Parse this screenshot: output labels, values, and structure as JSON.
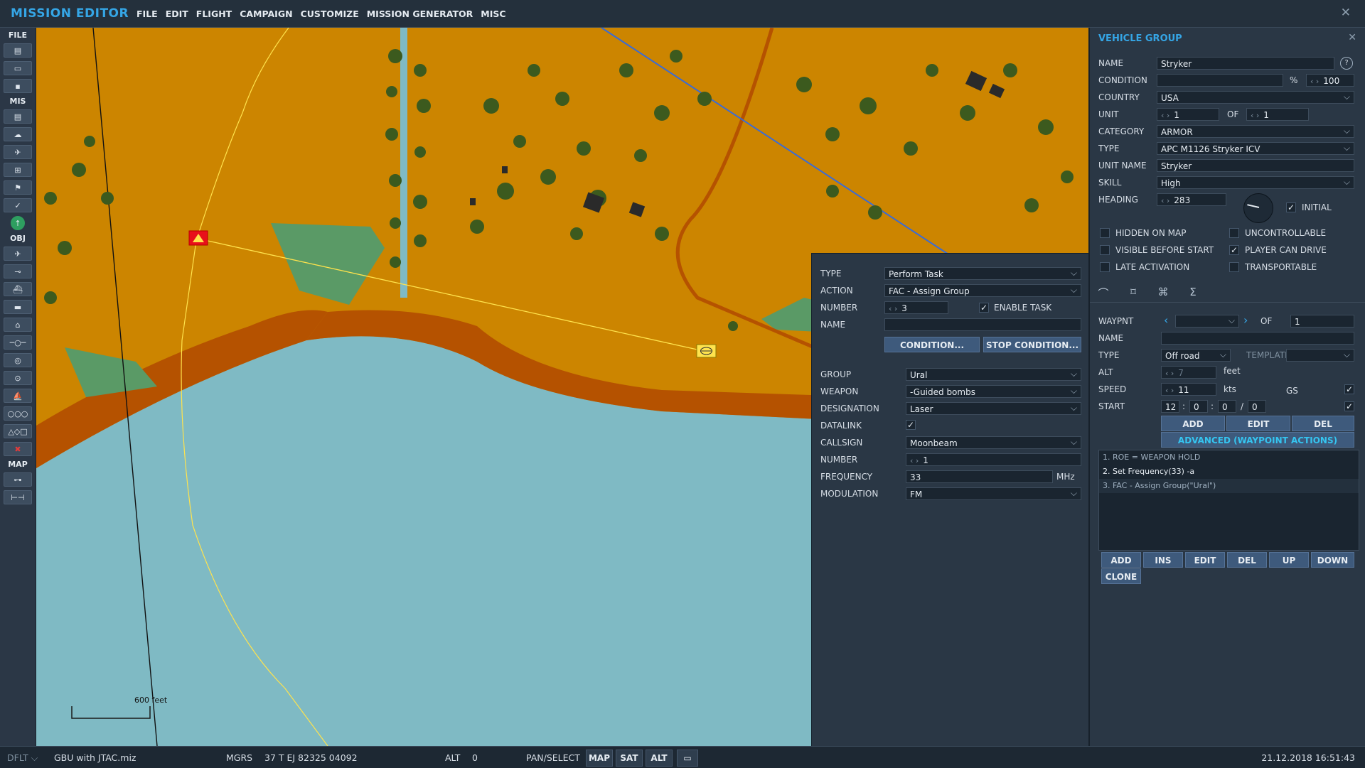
{
  "app": {
    "title": "MISSION EDITOR"
  },
  "menu": [
    "FILE",
    "EDIT",
    "FLIGHT",
    "CAMPAIGN",
    "CUSTOMIZE",
    "MISSION GENERATOR",
    "MISC"
  ],
  "toolbar": {
    "file_label": "FILE",
    "mis_label": "MIS",
    "obj_label": "OBJ",
    "map_label": "MAP"
  },
  "map": {
    "scale_label": "600 feet"
  },
  "task": {
    "type_label": "TYPE",
    "type_value": "Perform Task",
    "action_label": "ACTION",
    "action_value": "FAC - Assign Group",
    "number_label": "NUMBER",
    "number_value": "3",
    "enable_label": "ENABLE TASK",
    "name_label": "NAME",
    "name_value": "",
    "condition_btn": "CONDITION...",
    "stop_condition_btn": "STOP CONDITION...",
    "group_label": "GROUP",
    "group_value": "Ural",
    "weapon_label": "WEAPON",
    "weapon_value": "-Guided bombs",
    "designation_label": "DESIGNATION",
    "designation_value": "Laser",
    "datalink_label": "DATALINK",
    "callsign_label": "CALLSIGN",
    "callsign_value": "Moonbeam",
    "number2_label": "NUMBER",
    "number2_value": "1",
    "frequency_label": "FREQUENCY",
    "frequency_value": "33",
    "frequency_unit": "MHz",
    "modulation_label": "MODULATION",
    "modulation_value": "FM"
  },
  "vehicle": {
    "title": "VEHICLE GROUP",
    "name_label": "NAME",
    "name_value": "Stryker",
    "condition_label": "CONDITION",
    "condition_unit": "%",
    "condition_value": "100",
    "country_label": "COUNTRY",
    "country_value": "USA",
    "unit_label": "UNIT",
    "unit_value": "1",
    "unit_of": "OF",
    "unit_total": "1",
    "category_label": "CATEGORY",
    "category_value": "ARMOR",
    "type_label": "TYPE",
    "type_value": "APC M1126 Stryker ICV",
    "unitname_label": "UNIT NAME",
    "unitname_value": "Stryker",
    "skill_label": "SKILL",
    "skill_value": "High",
    "heading_label": "HEADING",
    "heading_value": "283",
    "initial_label": "INITIAL",
    "hidden_label": "HIDDEN ON MAP",
    "uncontrollable_label": "UNCONTROLLABLE",
    "visible_label": "VISIBLE BEFORE START",
    "playerdrive_label": "PLAYER CAN DRIVE",
    "late_label": "LATE ACTIVATION",
    "transportable_label": "TRANSPORTABLE"
  },
  "waypoint": {
    "waypnt_label": "WAYPNT",
    "of_label": "OF",
    "of_value": "1",
    "name_label": "NAME",
    "type_label": "TYPE",
    "type_value": "Off road",
    "template_label": "TEMPLATE",
    "alt_label": "ALT",
    "alt_value": "7",
    "alt_unit": "feet",
    "speed_label": "SPEED",
    "speed_value": "11",
    "speed_unit": "kts",
    "gs_label": "GS",
    "start_label": "START",
    "start_h": "12",
    "start_m": "0",
    "start_s": "0",
    "start_d": "0",
    "add_btn": "ADD",
    "edit_btn": "EDIT",
    "del_btn": "DEL",
    "advanced_btn": "ADVANCED (WAYPOINT ACTIONS)",
    "actions": [
      "1. ROE = WEAPON HOLD",
      "2. Set Frequency(33) -a",
      "3. FAC - Assign Group(\"Ural\")"
    ],
    "btns": [
      "ADD",
      "INS",
      "EDIT",
      "DEL",
      "UP",
      "DOWN",
      "CLONE"
    ]
  },
  "status": {
    "mode": "DFLT",
    "file": "GBU with JTAC.miz",
    "coord_label": "MGRS",
    "coord_value": "37 T EJ 82325 04092",
    "alt_label": "ALT",
    "alt_value": "0",
    "pan_label": "PAN/SELECT",
    "map_btn": "MAP",
    "sat_btn": "SAT",
    "alt_btn": "ALT",
    "datetime": "21.12.2018 16:51:43"
  },
  "colors": {
    "accent": "#35a6e6",
    "ground": "#cc8500",
    "water": "#7fbac4",
    "road": "#b55200",
    "trees": "#3c5a1e"
  }
}
